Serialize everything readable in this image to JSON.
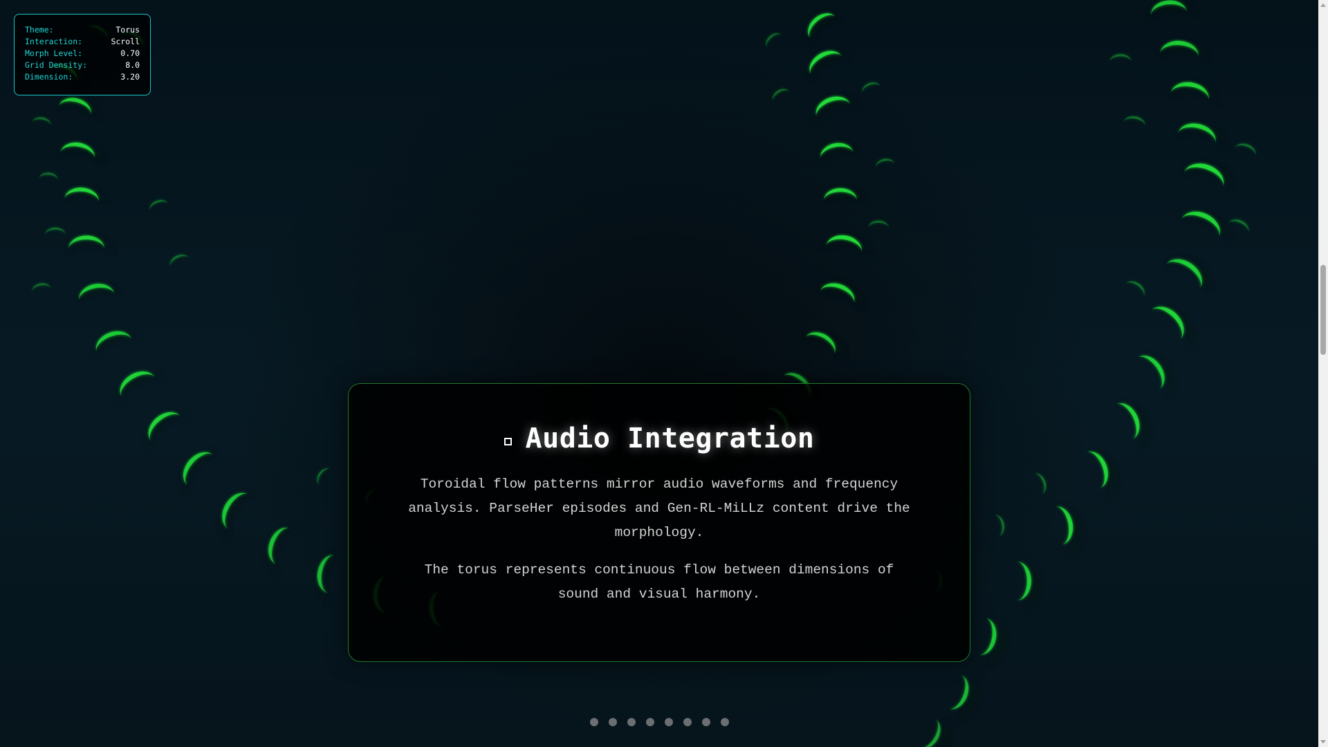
{
  "status": {
    "rows": [
      {
        "label": "Theme:",
        "value": "Torus"
      },
      {
        "label": "Interaction:",
        "value": "Scroll"
      },
      {
        "label": "Morph Level:",
        "value": "0.70"
      },
      {
        "label": "Grid Density:",
        "value": "8.0"
      },
      {
        "label": "Dimension:",
        "value": "3.20"
      }
    ]
  },
  "section": {
    "icon": "square-outline-icon",
    "title": "Audio Integration",
    "paragraph1": "Toroidal flow patterns mirror audio waveforms and frequency analysis. ParseHer episodes and Gen-RL-MiLLz content drive the morphology.",
    "paragraph2": "The torus represents continuous flow between dimensions of sound and visual harmony."
  },
  "navigation": {
    "dot_count": 8,
    "dot_color": "#6b6f72"
  },
  "colors": {
    "accent_cyan": "#19c6c6",
    "glow_green": "#22e23a",
    "card_border": "#1f7a2a",
    "background": "#06141c"
  }
}
